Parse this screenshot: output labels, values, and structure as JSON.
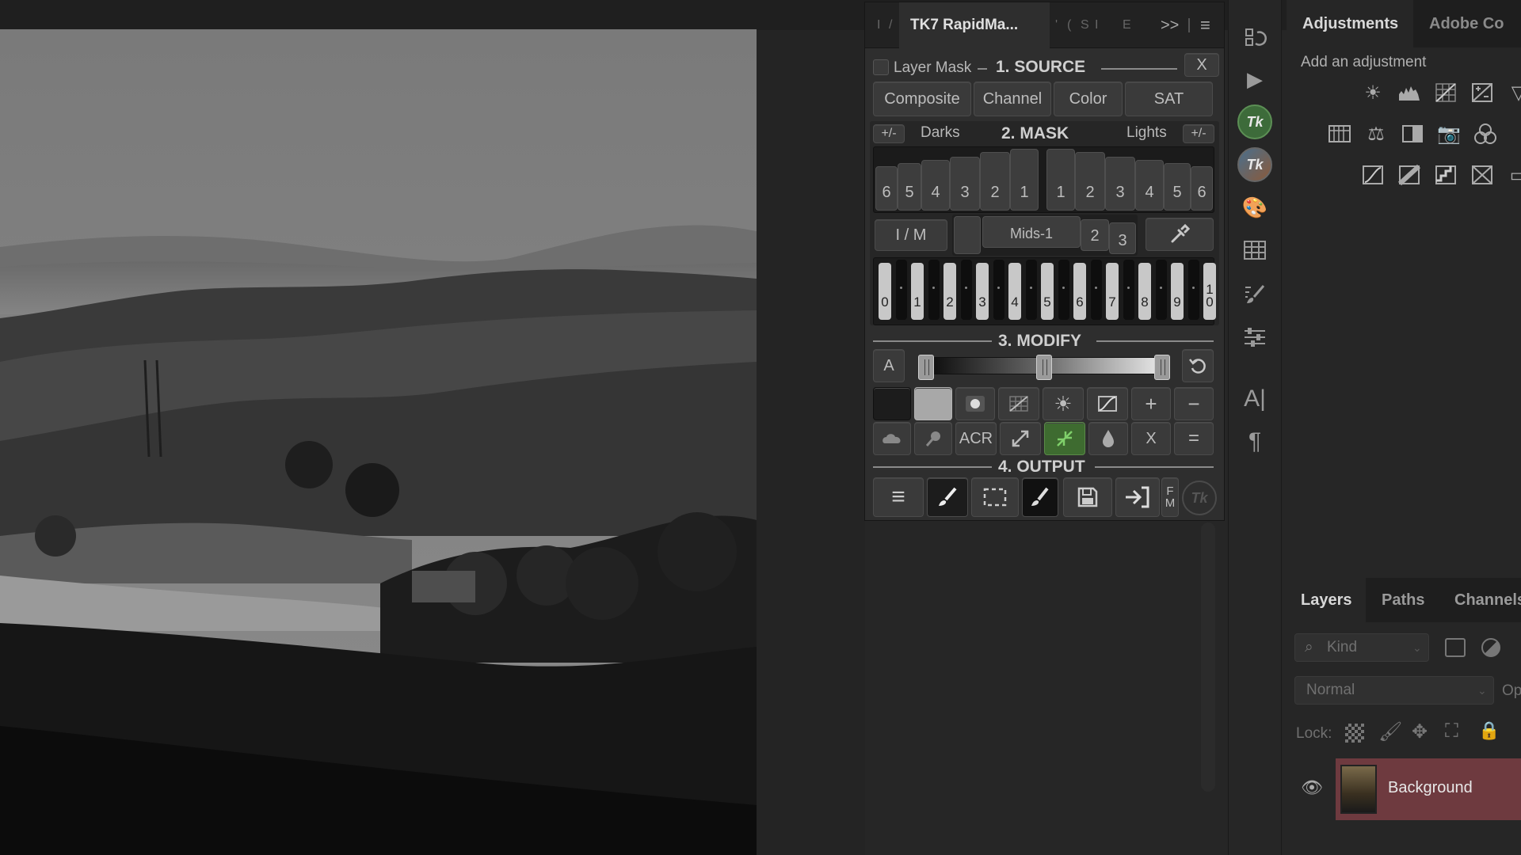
{
  "tk7": {
    "tab_title": "TK7 RapidMa...",
    "tab_chars": [
      "I",
      "/",
      "'",
      "(",
      "S",
      "I",
      "E"
    ],
    "overflow": ">>",
    "close_label": "X",
    "layer_mask_label": "Layer Mask",
    "source_heading": "1. SOURCE",
    "source_buttons": [
      "Composite",
      "Channel",
      "Color",
      "SAT"
    ],
    "mask": {
      "plus_minus": "+/-",
      "darks": "Darks",
      "heading": "2. MASK",
      "lights": "Lights",
      "dark_steps": [
        "6",
        "5",
        "4",
        "3",
        "2",
        "1"
      ],
      "light_steps": [
        "1",
        "2",
        "3",
        "4",
        "5",
        "6"
      ],
      "im_label": "I / M",
      "mids": "Mids-1",
      "mids_steps": [
        "2",
        "3"
      ],
      "zones": [
        "0",
        "1",
        "2",
        "3",
        "4",
        "5",
        "6",
        "7",
        "8",
        "9",
        "1\n0"
      ]
    },
    "modify": {
      "heading": "3. MODIFY",
      "a_label": "A",
      "plus": "+",
      "minus": "−",
      "acr": "ACR",
      "x": "X",
      "equals": "=",
      "slider_positions": [
        0.03,
        0.5,
        0.97
      ]
    },
    "output": {
      "heading": "4. OUTPUT",
      "fm": "F\nM"
    }
  },
  "adjustments": {
    "tab": "Adjustments",
    "second_tab": "Adobe Co",
    "add_label": "Add an adjustment"
  },
  "layers": {
    "tabs": [
      "Layers",
      "Paths",
      "Channels"
    ],
    "kind_placeholder": "Kind",
    "blend_mode": "Normal",
    "opacity_label": "Op",
    "lock_label": "Lock:",
    "layer_name": "Background"
  },
  "colors": {
    "accent_green": "#3e6b30",
    "selected_layer": "#6e3a3f"
  }
}
